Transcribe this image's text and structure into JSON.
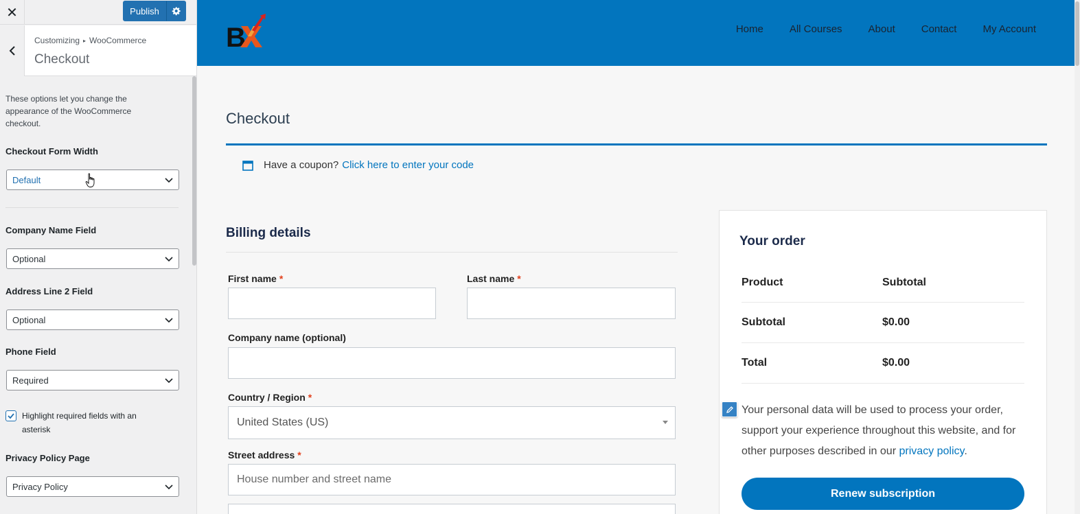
{
  "customizer": {
    "close_label": "✕",
    "publish_label": "Publish",
    "breadcrumb": {
      "root": "Customizing",
      "separator": "▸",
      "section": "WooCommerce"
    },
    "section_title": "Checkout",
    "description": "These options let you change the appearance of the WooCommerce checkout.",
    "controls": {
      "form_width": {
        "label": "Checkout Form Width",
        "value": "Default"
      },
      "company_name": {
        "label": "Company Name Field",
        "value": "Optional"
      },
      "address_line2": {
        "label": "Address Line 2 Field",
        "value": "Optional"
      },
      "phone": {
        "label": "Phone Field",
        "value": "Required"
      },
      "highlight_required": {
        "label": "Highlight required fields with an asterisk",
        "checked": true
      },
      "privacy_page": {
        "label": "Privacy Policy Page",
        "value": "Privacy Policy"
      }
    }
  },
  "site": {
    "brand_colors": {
      "primary": "#0275be",
      "header_bg": "#0275be"
    },
    "nav": [
      "Home",
      "All Courses",
      "About",
      "Contact",
      "My Account"
    ],
    "page_title": "Checkout",
    "coupon": {
      "text": "Have a coupon?",
      "link": "Click here to enter your code"
    },
    "billing": {
      "title": "Billing details",
      "required_mark": "*",
      "first_name": {
        "label": "First name",
        "value": ""
      },
      "last_name": {
        "label": "Last name",
        "value": ""
      },
      "company": {
        "label": "Company name (optional)",
        "value": ""
      },
      "country": {
        "label": "Country / Region",
        "value": "United States (US)"
      },
      "street": {
        "label": "Street address",
        "placeholder": "House number and street name"
      }
    },
    "order": {
      "title": "Your order",
      "headers": {
        "product": "Product",
        "subtotal": "Subtotal"
      },
      "rows": [
        {
          "label": "Subtotal",
          "value": "$0.00"
        },
        {
          "label": "Total",
          "value": "$0.00"
        }
      ],
      "privacy_text": "Your personal data will be used to process your order, support your experience throughout this website, and for other purposes described in our",
      "privacy_link": "privacy policy",
      "privacy_end": ".",
      "button": "Renew subscription"
    }
  }
}
